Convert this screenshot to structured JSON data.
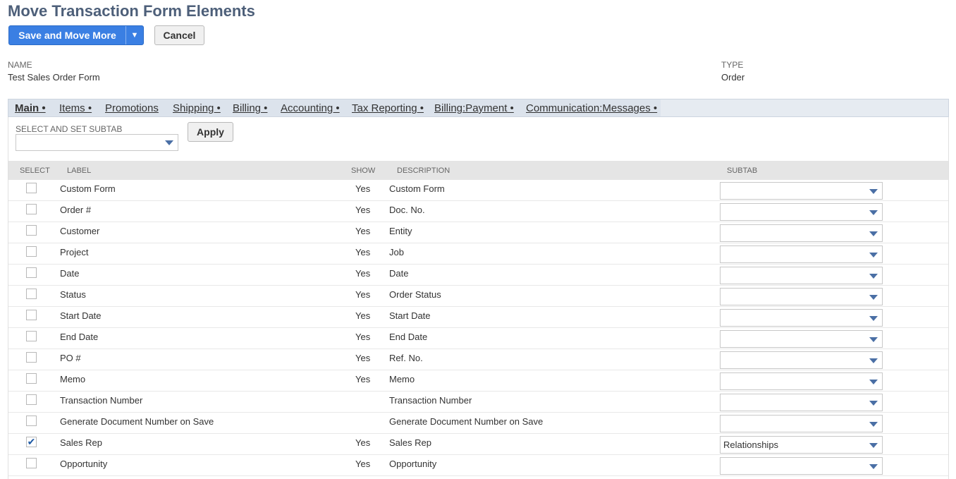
{
  "page": {
    "title": "Move Transaction Form Elements"
  },
  "actions": {
    "save_label": "Save and Move More",
    "cancel_label": "Cancel"
  },
  "fields": {
    "name_label": "NAME",
    "name_value": "Test Sales Order Form",
    "type_label": "TYPE",
    "type_value": "Order"
  },
  "tabs": [
    {
      "label": "Main •",
      "active": true
    },
    {
      "label": "Items •"
    },
    {
      "label": "Promotions"
    },
    {
      "label": "Shipping •"
    },
    {
      "label": "Billing •"
    },
    {
      "label": "Accounting •"
    },
    {
      "label": "Tax Reporting •"
    },
    {
      "label": "Billing:Payment •"
    },
    {
      "label": "Communication:Messages •"
    }
  ],
  "subtab_select": {
    "label": "SELECT AND SET SUBTAB",
    "value": "",
    "apply_label": "Apply"
  },
  "table": {
    "headers": {
      "select": "SELECT",
      "label": "LABEL",
      "show": "SHOW",
      "description": "DESCRIPTION",
      "subtab": "SUBTAB"
    },
    "rows": [
      {
        "checked": false,
        "label": "Custom Form",
        "show": "Yes",
        "description": "Custom Form",
        "subtab": ""
      },
      {
        "checked": false,
        "label": "Order #",
        "show": "Yes",
        "description": "Doc. No.",
        "subtab": ""
      },
      {
        "checked": false,
        "label": "Customer",
        "show": "Yes",
        "description": "Entity",
        "subtab": ""
      },
      {
        "checked": false,
        "label": "Project",
        "show": "Yes",
        "description": "Job",
        "subtab": ""
      },
      {
        "checked": false,
        "label": "Date",
        "show": "Yes",
        "description": "Date",
        "subtab": ""
      },
      {
        "checked": false,
        "label": "Status",
        "show": "Yes",
        "description": "Order Status",
        "subtab": ""
      },
      {
        "checked": false,
        "label": "Start Date",
        "show": "Yes",
        "description": "Start Date",
        "subtab": ""
      },
      {
        "checked": false,
        "label": "End Date",
        "show": "Yes",
        "description": "End Date",
        "subtab": ""
      },
      {
        "checked": false,
        "label": "PO #",
        "show": "Yes",
        "description": "Ref. No.",
        "subtab": ""
      },
      {
        "checked": false,
        "label": "Memo",
        "show": "Yes",
        "description": "Memo",
        "subtab": ""
      },
      {
        "checked": false,
        "label": "Transaction Number",
        "show": "",
        "description": "Transaction Number",
        "subtab": ""
      },
      {
        "checked": false,
        "label": "Generate Document Number on Save",
        "show": "",
        "description": "Generate Document Number on Save",
        "subtab": ""
      },
      {
        "checked": true,
        "label": "Sales Rep",
        "show": "Yes",
        "description": "Sales Rep",
        "subtab": "Relationships"
      },
      {
        "checked": false,
        "label": "Opportunity",
        "show": "Yes",
        "description": "Opportunity",
        "subtab": ""
      }
    ]
  },
  "colors": {
    "primary": "#3a7fe3",
    "title": "#4d5f79",
    "tabbar": "#dce3ec",
    "checkmark": "#1f5aa5"
  }
}
